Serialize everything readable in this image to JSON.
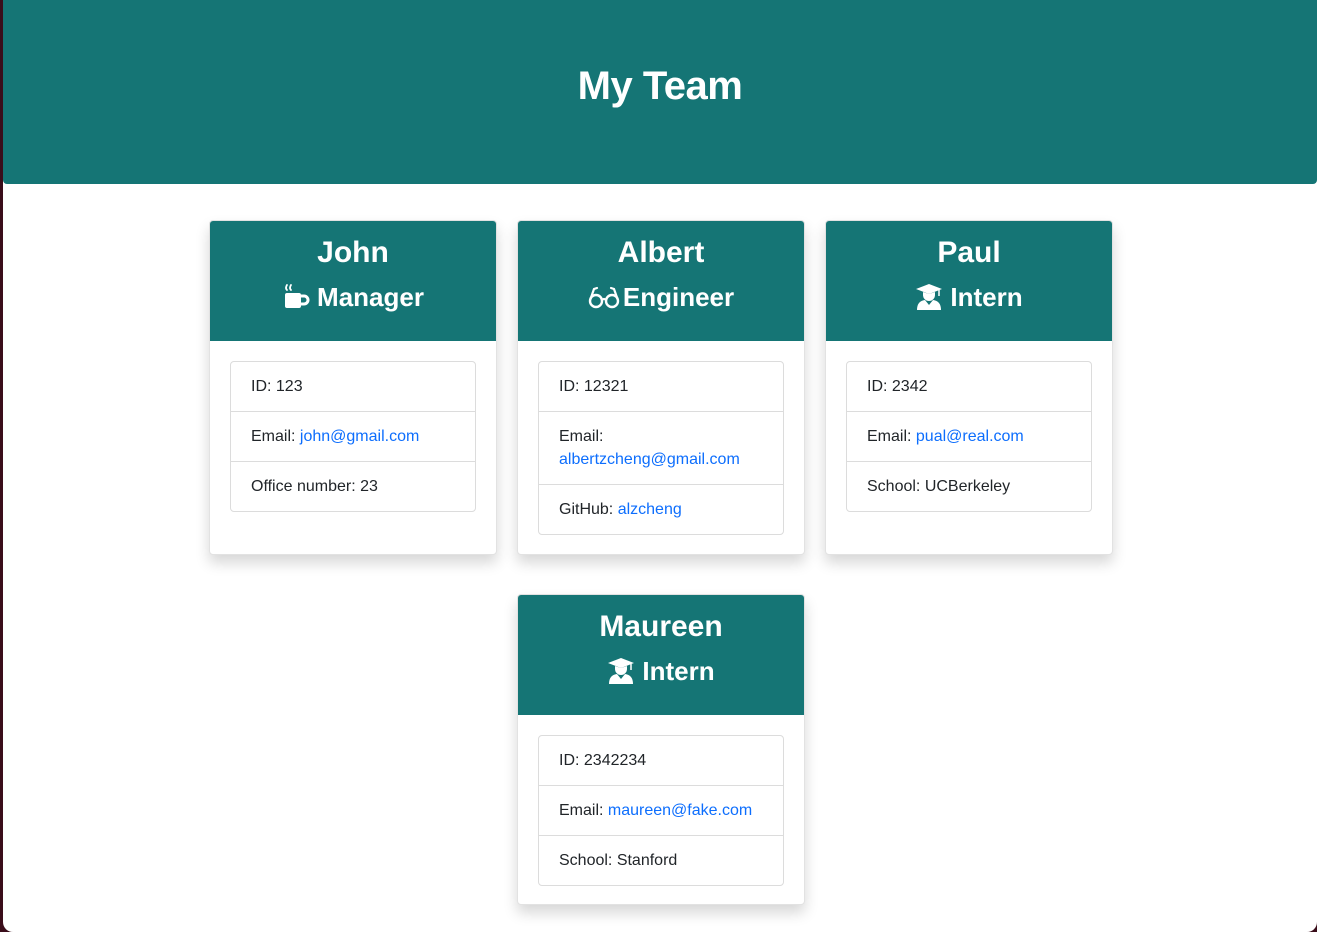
{
  "page_title": "My Team",
  "colors": {
    "header_bg": "#157575",
    "link": "#0d6efd"
  },
  "cards": [
    {
      "name": "John",
      "role": "Manager",
      "role_icon": "coffee-mug-icon",
      "id_label": "ID: ",
      "id_value": "123",
      "email_label": "Email: ",
      "email": "john@gmail.com",
      "extra_label": "Office number: ",
      "extra_value": "23"
    },
    {
      "name": "Albert",
      "role": "Engineer",
      "role_icon": "glasses-icon",
      "id_label": "ID: ",
      "id_value": "12321",
      "email_label": "Email:",
      "email": "albertzcheng@gmail.com",
      "extra_label": "GitHub: ",
      "extra_value": "alzcheng"
    },
    {
      "name": "Paul",
      "role": "Intern",
      "role_icon": "graduate-icon",
      "id_label": "ID: ",
      "id_value": "2342",
      "email_label": "Email: ",
      "email": "pual@real.com",
      "extra_label": "School: ",
      "extra_value": "UCBerkeley"
    },
    {
      "name": "Maureen",
      "role": "Intern",
      "role_icon": "graduate-icon",
      "id_label": "ID: ",
      "id_value": "2342234",
      "email_label": "Email: ",
      "email": "maureen@fake.com",
      "extra_label": "School: ",
      "extra_value": "Stanford"
    }
  ]
}
